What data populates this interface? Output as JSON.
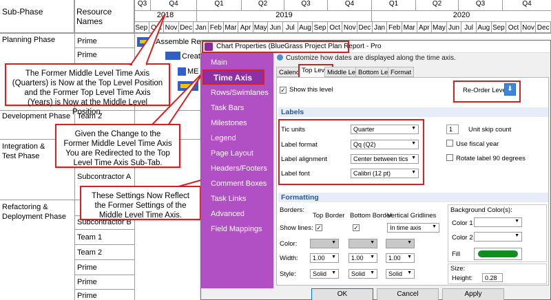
{
  "grid": {
    "col_subphase": "Sub-Phase",
    "col_resource": "Resource Names",
    "quarters": [
      "Q3",
      "Q4",
      "Q1",
      "Q2",
      "Q3",
      "Q4",
      "Q1",
      "Q2",
      "Q3",
      "Q4"
    ],
    "years": [
      "2018",
      "2019",
      "2020"
    ],
    "months": [
      "Sep",
      "Oct",
      "Nov",
      "Dec",
      "Jan",
      "Feb",
      "Mar",
      "Apr",
      "May",
      "Jun",
      "Jul",
      "Aug",
      "Sep",
      "Oct",
      "Nov",
      "Dec",
      "Jan",
      "Feb",
      "Mar",
      "Apr",
      "May",
      "Jun",
      "Jul",
      "Aug",
      "Sep",
      "Oct",
      "Nov",
      "Dec"
    ],
    "phases": [
      "Planning Phase",
      "Development Phase",
      "Integration & Test Phase",
      "Refactoring & Deployment Phase"
    ],
    "resources": [
      "Prime",
      "Prime",
      "Team 2",
      "Subcontractor A",
      "Subcontractor B",
      "Team 1",
      "Team 2",
      "Prime",
      "Prime",
      "Prime"
    ],
    "task_labels": [
      "Assemble Res",
      "Create",
      "ME"
    ]
  },
  "callouts": {
    "c1": "The Former Middle Level Time Axis (Quarters) is Now at the Top Level Position and the Former Top Level Time Axis (Years) is Now at the Middle Level Position.",
    "c2": "Given the Change to the Former Middle Level Time Axis You are Redirected to the Top Level Time Axis Sub-Tab.",
    "c3": "These Settings Now Reflect the Former Settings of the Middle Level Time Axis."
  },
  "dialog": {
    "title": "Chart Properties (BlueGrass Project Plan Report - Pro",
    "nav": [
      "Main",
      "Time Axis",
      "Rows/Swimlanes",
      "Task Bars",
      "Milestones",
      "Legend",
      "Page Layout",
      "Headers/Footers",
      "Comment Boxes",
      "Task Links",
      "Advanced",
      "Field Mappings"
    ],
    "hint": "Customize how dates are displayed along the time axis.",
    "tabs": [
      "Calendar",
      "Top Level",
      "Middle Level",
      "Bottom Level",
      "Format"
    ],
    "show_level": "Show this level",
    "reorder": "Re-Order Levels",
    "labels_head": "Labels",
    "tic_units": "Tic units",
    "tic_units_val": "Quarter",
    "label_format": "Label format",
    "label_format_val": "Qq (Q2)",
    "label_align": "Label alignment",
    "label_align_val": "Center between tics",
    "label_font": "Label font",
    "label_font_val": "Calibri (12 pt)",
    "skip_val": "1",
    "skip_label": "Unit skip count",
    "fiscal": "Use fiscal year",
    "rotate": "Rotate label 90 degrees",
    "formatting_head": "Formatting",
    "borders": "Borders:",
    "top_border": "Top Border",
    "bottom_border": "Bottom Border",
    "vert_grid": "Vertical Gridlines",
    "show_lines": "Show lines:",
    "grid_val": "In time axis",
    "color": "Color:",
    "width": "Width:",
    "style": "Style:",
    "width_vals": [
      "1.00",
      "1.00",
      "1.00"
    ],
    "style_vals": [
      "Solid",
      "Solid",
      "Solid"
    ],
    "bg_colors": "Background Color(s):",
    "color1": "Color 1",
    "color2": "Color 2",
    "fill": "Fill",
    "fill_color": "#0f8f1f",
    "size": "Size:",
    "height": "Height:",
    "height_val": "0.28",
    "ok": "OK",
    "cancel": "Cancel",
    "apply": "Apply"
  },
  "colors": {
    "accent": "#d62020",
    "nav": "#b14fc5",
    "nav_active": "#8f2fa5",
    "bar_blue": "#2f5fc8",
    "bar_yellow": "#f2c200"
  }
}
